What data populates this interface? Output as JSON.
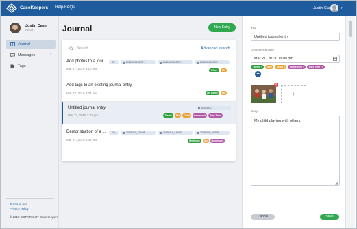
{
  "app": {
    "brand": "CaseKeepers",
    "nav_help": "Help/FAQs",
    "user_name": "Justin Case"
  },
  "icons": {
    "logo": "diamond-logo-icon",
    "chevron": "chevron-down-icon",
    "search": "search-icon",
    "calendar": "calendar-icon",
    "journal": "book-icon",
    "messages": "chat-bubble-icon",
    "tags": "tag-icon"
  },
  "sidebar": {
    "profile_name": "Justin Case",
    "profile_role": "Client",
    "items": [
      {
        "label": "Journal",
        "active": true
      },
      {
        "label": "Messages",
        "active": false
      },
      {
        "label": "Tags",
        "active": false
      }
    ],
    "messages_arrow": "›",
    "terms": "Terms of use",
    "privacy": "Privacy policy",
    "copyright": "© 2019 COPYRIGHT CaseKeepers"
  },
  "journal": {
    "title": "Journal",
    "new_entry": "New Entry",
    "search_placeholder": "Search",
    "advanced_search": "Advanced search  ⌄",
    "entries": [
      {
        "title": "Add photos to a jour...",
        "date": "Mar 27, 2019 4:10 pm",
        "more": "3+",
        "files": [
          "20190315063257...",
          "20190315063257...",
          "20190315063257..."
        ],
        "tags": [
          {
            "label": "Office",
            "color": "#2e9e3e"
          },
          {
            "label": "Me",
            "color": "#e8a33d"
          }
        ]
      },
      {
        "title": "Add tags to an existing journal entry",
        "date": "Mar 27, 2019 4:04 pm",
        "more": "",
        "files": [],
        "tags": [
          {
            "label": "My Home",
            "color": "#2e9e3e"
          },
          {
            "label": "Me",
            "color": "#e8a33d"
          }
        ]
      },
      {
        "title": "Untitled journal entry",
        "date": "Mar 27, 2019 3:31 pm",
        "more": "",
        "files": [
          "DSC00007"
        ],
        "tags": [
          {
            "label": "Travel",
            "color": "#2e9e3e"
          },
          {
            "label": "Me",
            "color": "#e8a33d"
          },
          {
            "label": "Child",
            "color": "#e8a33d"
          },
          {
            "label": "Homework",
            "color": "#b05aa8"
          },
          {
            "label": "Play Time",
            "color": "#b05aa8"
          }
        ]
      },
      {
        "title": "Demonstration of a ...",
        "date": "Mar 27, 2019 3:09 pm",
        "more": "3+",
        "files": [
          "20190316_135428",
          "20190316_135030",
          "20190306_164849"
        ],
        "tags": [
          {
            "label": "My Home",
            "color": "#2e9e3e"
          },
          {
            "label": "Me",
            "color": "#e8a33d"
          },
          {
            "label": "Homework",
            "color": "#b05aa8"
          }
        ]
      }
    ]
  },
  "editor": {
    "title_label": "Title",
    "title_value": "Untitled journal entry",
    "date_label": "Occurrence Date",
    "date_value": "Mar 21, 2019 03:00 pm",
    "tags": [
      {
        "label": "Travel",
        "color": "#2e9e3e"
      },
      {
        "label": "Me",
        "color": "#e8a33d"
      },
      {
        "label": "Child",
        "color": "#e8a33d"
      },
      {
        "label": "Homework",
        "color": "#b05aa8"
      },
      {
        "label": "Play Time",
        "color": "#b05aa8"
      }
    ],
    "add_tag": "+",
    "photo_remove": "×",
    "add_photo": "+",
    "body_label": "Body",
    "body_value": "My child playing with others.",
    "cancel": "Cancel",
    "save": "Save"
  }
}
